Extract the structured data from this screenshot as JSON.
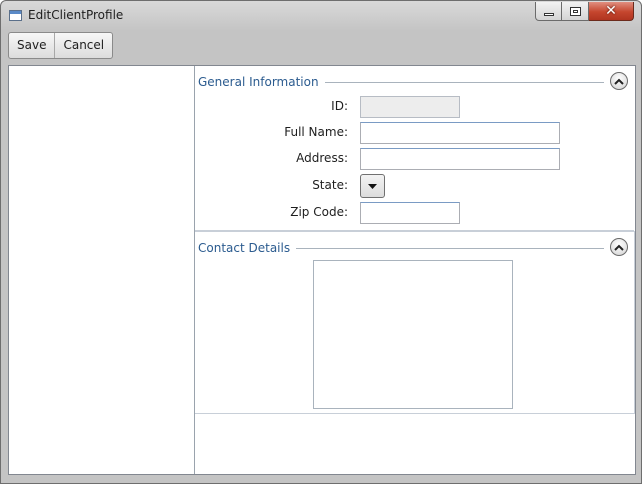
{
  "window": {
    "title": "EditClientProfile",
    "app_icon": "window-icon",
    "caption": {
      "minimize_icon": "minimize-icon",
      "maximize_icon": "maximize-icon",
      "close_icon": "close-icon",
      "close_glyph": "✕"
    }
  },
  "toolbar": {
    "save_label": "Save",
    "cancel_label": "Cancel"
  },
  "general": {
    "title": "General Information",
    "fields": {
      "id": {
        "label": "ID:",
        "value": ""
      },
      "full_name": {
        "label": "Full Name:",
        "value": ""
      },
      "address": {
        "label": "Address:",
        "value": ""
      },
      "state": {
        "label": "State:",
        "value": ""
      },
      "zip": {
        "label": "Zip Code:",
        "value": ""
      }
    }
  },
  "contact": {
    "title": "Contact Details"
  },
  "colors": {
    "section_title": "#2b5b8f",
    "close_button": "#c5462e"
  }
}
